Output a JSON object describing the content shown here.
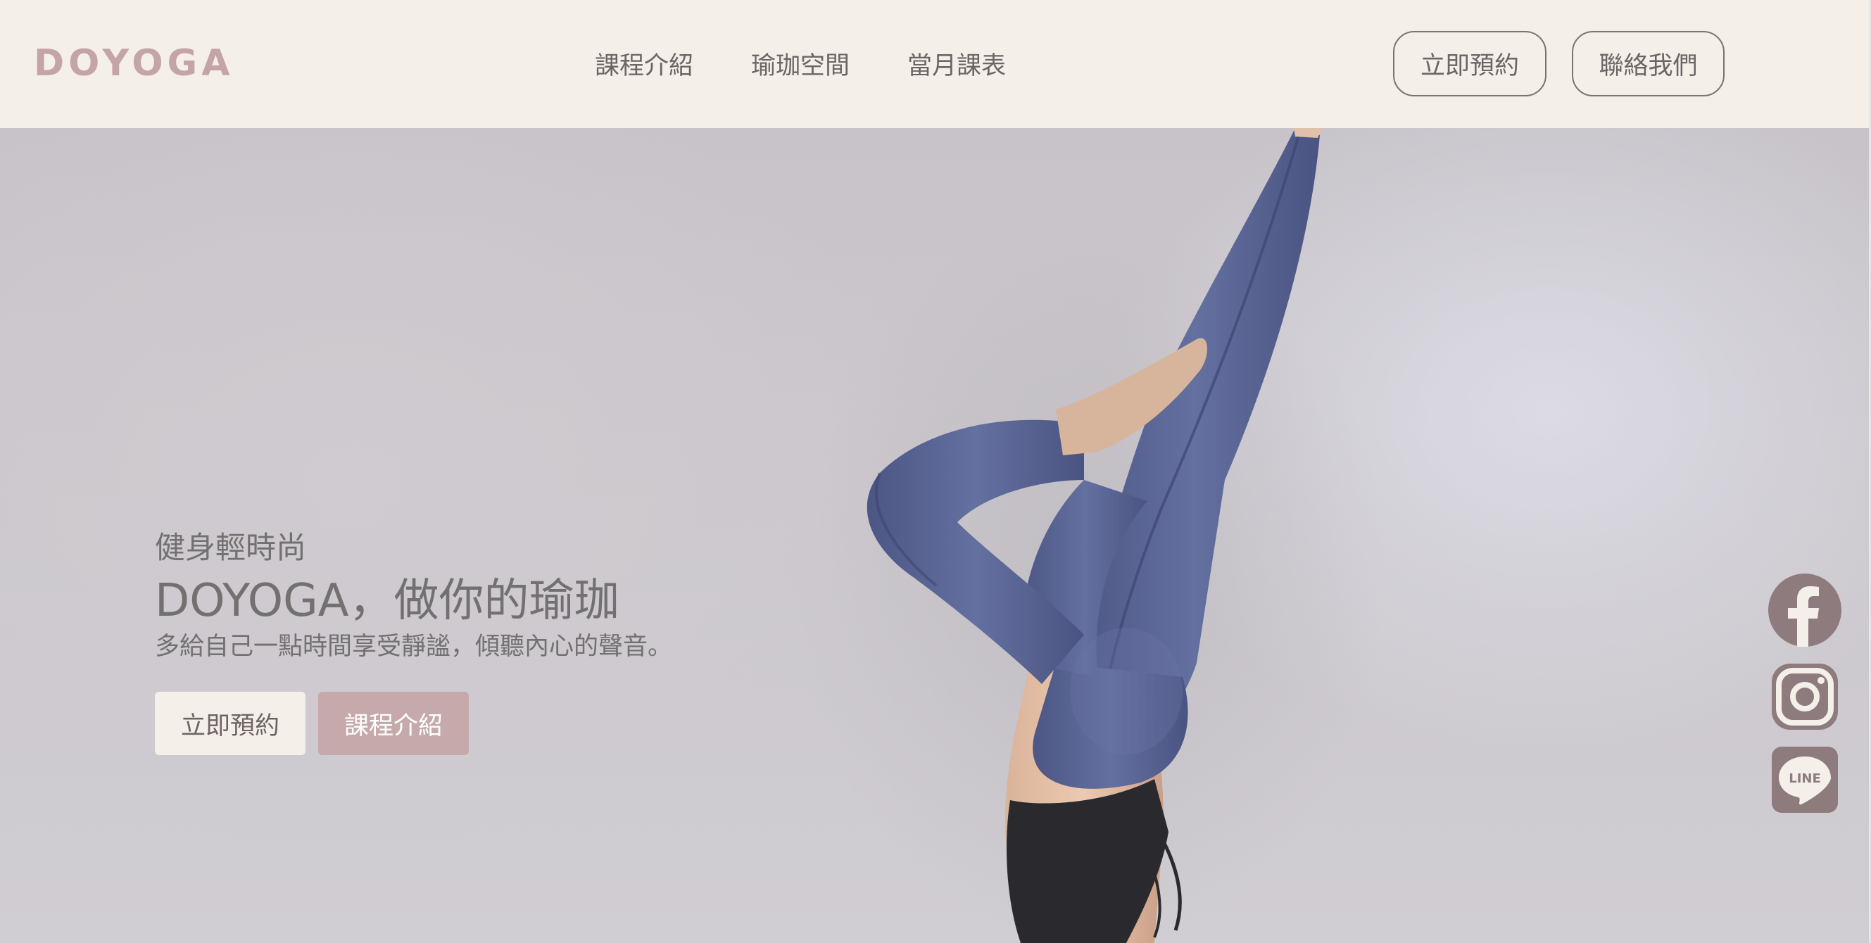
{
  "brand": {
    "logo": "DOYOGA"
  },
  "nav": {
    "items": [
      {
        "label": "課程介紹"
      },
      {
        "label": "瑜珈空間"
      },
      {
        "label": "當月課表"
      }
    ]
  },
  "header_actions": {
    "book_label": "立即預約",
    "contact_label": "聯絡我們"
  },
  "hero": {
    "tagline": "健身輕時尚",
    "headline": "DOYOGA，做你的瑜珈",
    "subline": "多給自己一點時間享受靜謐，傾聽內心的聲音。",
    "primary_cta": "立即預約",
    "secondary_cta": "課程介紹",
    "image": "woman-yoga-headstand-photo"
  },
  "social": {
    "items": [
      {
        "icon": "facebook-icon"
      },
      {
        "icon": "instagram-icon"
      },
      {
        "icon": "line-icon",
        "label": "LINE"
      }
    ]
  },
  "colors": {
    "header_bg": "#f4efe9",
    "logo": "#c4a4a4",
    "text": "#6e6466",
    "accent": "#c6aaab",
    "social": "#8e7b7d"
  }
}
